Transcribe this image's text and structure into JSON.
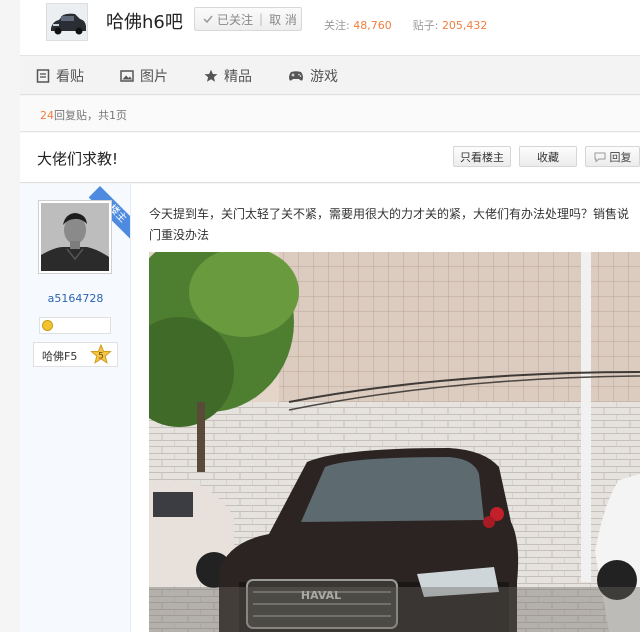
{
  "forum": {
    "name": "哈佛h6吧",
    "follow_label": "已关注",
    "unfollow_label": "取 消",
    "follow_count_label": "关注:",
    "follow_count": "48,760",
    "post_count_label": "贴子:",
    "post_count": "205,432"
  },
  "nav": {
    "items": [
      {
        "label": "看贴",
        "icon": "document-icon"
      },
      {
        "label": "图片",
        "icon": "image-icon"
      },
      {
        "label": "精品",
        "icon": "star-icon"
      },
      {
        "label": "游戏",
        "icon": "gamepad-icon"
      }
    ]
  },
  "replies": {
    "count": "24",
    "label": "回复贴，共",
    "pages": "1",
    "pages_suffix": "页"
  },
  "thread": {
    "title": "大佬们求教!",
    "only_author_label": "只看楼主",
    "favorite_label": "收藏",
    "reply_label": "回复"
  },
  "post": {
    "ribbon_label": "楼主",
    "username": "a5164728",
    "level_name": "哈佛F5",
    "level_number": "5",
    "content": "今天提到车，关门太轻了关不紧，需要用很大的力才关的紧，大佬们有办法处理吗？销售说门重没办法",
    "image_text": "HAVAL"
  },
  "colors": {
    "accent_orange": "#f17e3e",
    "link_blue": "#2d64b3",
    "ribbon_blue": "#4e8be0"
  }
}
